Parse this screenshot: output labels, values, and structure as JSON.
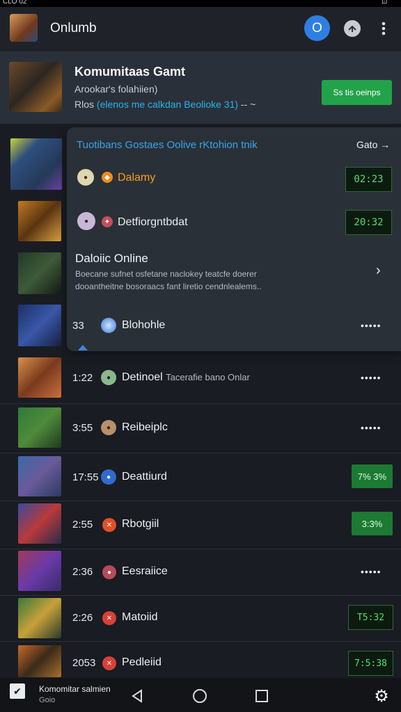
{
  "status": {
    "time": "CLO 02",
    "right": "⊡"
  },
  "appbar": {
    "title": "Onlumb",
    "circle_label": "O"
  },
  "featured": {
    "title": "Komumitaas Gamt",
    "subtitle": "Arookar's folahiien)",
    "tag_prefix": "Rlos",
    "tag_highlight": "(elenos me calkdan Beolioke 31)",
    "tag_suffix": "-- ~",
    "button_label": "Ss tis oeinps"
  },
  "popover": {
    "title": "Tuotibans Gostaes Oolive rKtohion tnik",
    "go_label": "Gato",
    "rows": [
      {
        "name": "Dalamy",
        "timer": "02:23",
        "color": "#f0a020"
      },
      {
        "name": "Detfiorgntbdat",
        "timer": "20:32",
        "color": "#e9ecf0"
      }
    ],
    "online": {
      "title": "Daloiic Online",
      "desc_line1": "Boecane sufnet osfetane naclokey teatcfe doerer",
      "desc_line2": "dooantheitne bosoraacs fant liretio cendnlealems.."
    }
  },
  "list": [
    {
      "time": "33",
      "name": "Blohohle",
      "sub": "",
      "action": "more",
      "badge": ""
    },
    {
      "time": "1:22",
      "name": "Detinoel",
      "sub": "Tacerafie bano Onlar",
      "action": "more",
      "badge": ""
    },
    {
      "time": "3:55",
      "name": "Reibeiplc",
      "sub": "",
      "action": "more",
      "badge": ""
    },
    {
      "time": "17:55",
      "name": "Deattiurd",
      "sub": "",
      "action": "badge-green",
      "badge": "7% 3%"
    },
    {
      "time": "2:55",
      "name": "Rbotgiil",
      "sub": "",
      "action": "badge-green",
      "badge": "3:3%"
    },
    {
      "time": "2:36",
      "name": "Eesraiice",
      "sub": "",
      "action": "more",
      "badge": ""
    },
    {
      "time": "2:26",
      "name": "Matoiid",
      "sub": "",
      "action": "badge-dark",
      "badge": "T5:32"
    },
    {
      "time": "2053",
      "name": "Pedleiid",
      "sub": "",
      "action": "badge-dark",
      "badge": "7:5:38"
    }
  ],
  "more_label": "•••••",
  "navbar": {
    "line1": "Komomitar salmien",
    "line2": "Goio"
  },
  "icons": {
    "share": "share-icon",
    "kebab": "kebab-menu-icon",
    "chevron": "chevron-right-icon",
    "back": "back-triangle-icon",
    "home": "home-circle-icon",
    "recent": "recent-square-icon",
    "settings": "gear-icon"
  },
  "colors": {
    "accent_blue": "#2f7fe3",
    "accent_green": "#22a34a",
    "timer_green": "#4fe06a",
    "link_blue": "#37a6ec"
  }
}
